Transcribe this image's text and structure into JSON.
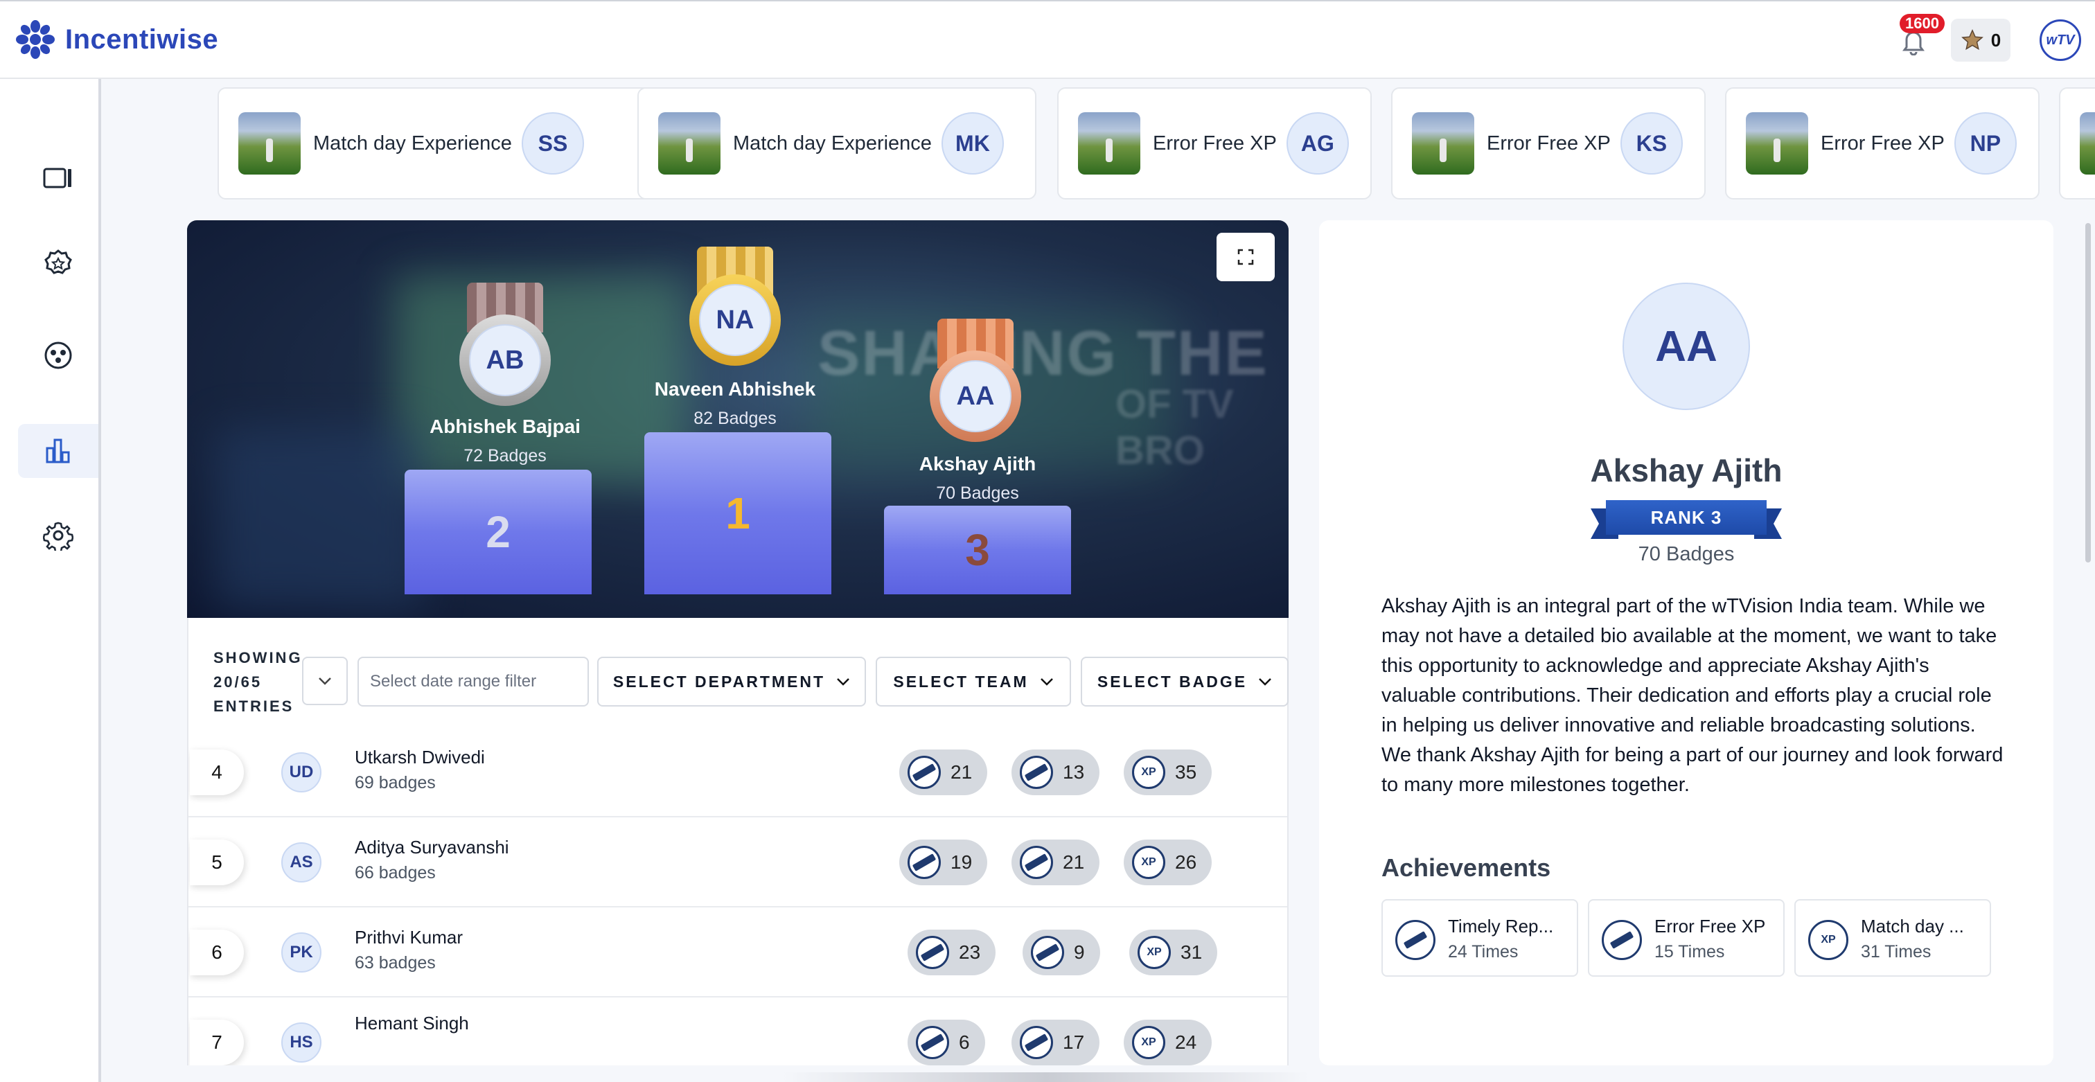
{
  "app": {
    "name": "Incentiwise",
    "brand_color": "#2b47b8"
  },
  "header": {
    "notifications": {
      "count": "1600",
      "icon": "bell-icon"
    },
    "stars": {
      "value": "0",
      "icon": "star-icon"
    },
    "user_avatar_initials": "wTV"
  },
  "sidebar": {
    "items": [
      {
        "name": "dashboard",
        "icon": "panel-icon",
        "active": false
      },
      {
        "name": "badges",
        "icon": "badge-star-icon",
        "active": false
      },
      {
        "name": "teams",
        "icon": "group-icon",
        "active": false
      },
      {
        "name": "leaderboard",
        "icon": "bar-chart-icon",
        "active": true
      },
      {
        "name": "settings",
        "icon": "gear-icon",
        "active": false
      }
    ]
  },
  "recent_awards": [
    {
      "title": "Match day Experience",
      "initials": "SS"
    },
    {
      "title": "Match day Experience",
      "initials": "MK"
    },
    {
      "title": "Error Free XP",
      "initials": "AG"
    },
    {
      "title": "Error Free XP",
      "initials": "KS"
    },
    {
      "title": "Error Free XP",
      "initials": "NP"
    }
  ],
  "podium": {
    "background_text": [
      "SHAPING THE FU",
      "OF TV BRO"
    ],
    "first": {
      "initials": "NA",
      "name": "Naveen Abhishek",
      "badges": "82 Badges",
      "rank": "1",
      "rank_color": "#f5b82e"
    },
    "second": {
      "initials": "AB",
      "name": "Abhishek Bajpai",
      "badges": "72 Badges",
      "rank": "2",
      "rank_color": "#d9dcef"
    },
    "third": {
      "initials": "AA",
      "name": "Akshay Ajith",
      "badges": "70 Badges",
      "rank": "3",
      "rank_color": "#8a4a3c"
    }
  },
  "filters": {
    "showing_text": "SHOWING 20/65 ENTRIES",
    "date_placeholder": "Select date range filter",
    "department": "SELECT DEPARTMENT",
    "team": "SELECT TEAM",
    "badge": "SELECT BADGE"
  },
  "leaderboard": [
    {
      "rank": "4",
      "initials": "UD",
      "name": "Utkarsh Dwivedi",
      "badges": "69 badges",
      "counts": [
        "21",
        "13",
        "35"
      ]
    },
    {
      "rank": "5",
      "initials": "AS",
      "name": "Aditya Suryavanshi",
      "badges": "66 badges",
      "counts": [
        "19",
        "21",
        "26"
      ]
    },
    {
      "rank": "6",
      "initials": "PK",
      "name": "Prithvi Kumar",
      "badges": "63 badges",
      "counts": [
        "23",
        "9",
        "31"
      ]
    },
    {
      "rank": "7",
      "initials": "HS",
      "name": "Hemant Singh",
      "badges": "",
      "counts": [
        "6",
        "17",
        "24"
      ]
    }
  ],
  "profile": {
    "initials": "AA",
    "name": "Akshay Ajith",
    "rank_label": "RANK 3",
    "badges": "70 Badges",
    "bio": "Akshay Ajith is an integral part of the wTVision India team. While we may not have a detailed bio available at the moment, we want to take this opportunity to acknowledge and appreciate Akshay Ajith's valuable contributions. Their dedication and efforts play a crucial role in helping us deliver innovative and reliable broadcasting solutions. We thank Akshay Ajith for being a part of our journey and look forward to many more milestones together.",
    "achievements_title": "Achievements",
    "achievements": [
      {
        "name": "Timely Rep...",
        "times": "24 Times",
        "icon": "stamp-badge-icon"
      },
      {
        "name": "Error Free XP",
        "times": "15 Times",
        "icon": "stamp-badge-icon"
      },
      {
        "name": "Match day ...",
        "times": "31 Times",
        "icon": "xp-badge-icon"
      }
    ]
  }
}
